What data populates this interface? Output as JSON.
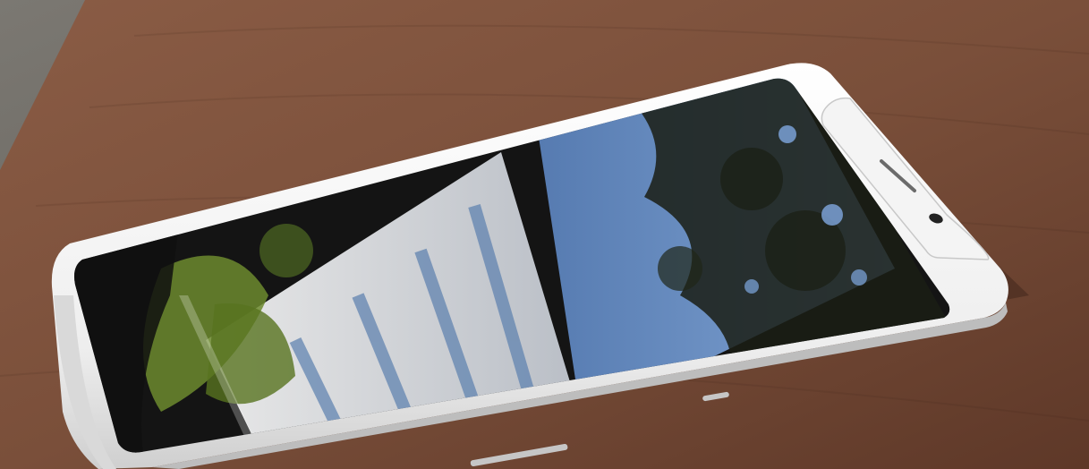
{
  "scene": {
    "subject": "smartphone-on-table",
    "colors": {
      "table": "#7a4f3a",
      "table_dark": "#5a3626",
      "floor": "#6d6a63",
      "phone_body": "#f2f2f2",
      "screen": "#141414",
      "sky_reflection": "#7fa8e0",
      "leaf_reflection": "#6c8a2e"
    }
  }
}
